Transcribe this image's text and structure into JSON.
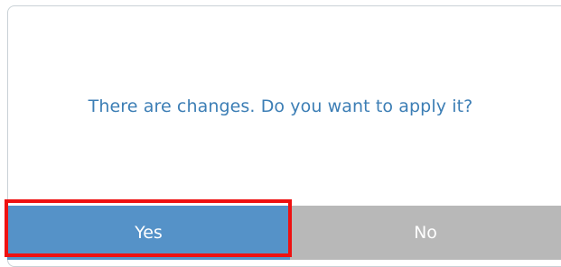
{
  "dialog": {
    "message": "There are changes. Do you want to apply it?",
    "yes_label": "Yes",
    "no_label": "No"
  },
  "colors": {
    "message_text": "#3c7eb5",
    "yes_button": "#5592c8",
    "no_button": "#b8b8b8",
    "highlight_border": "#ee1111"
  }
}
